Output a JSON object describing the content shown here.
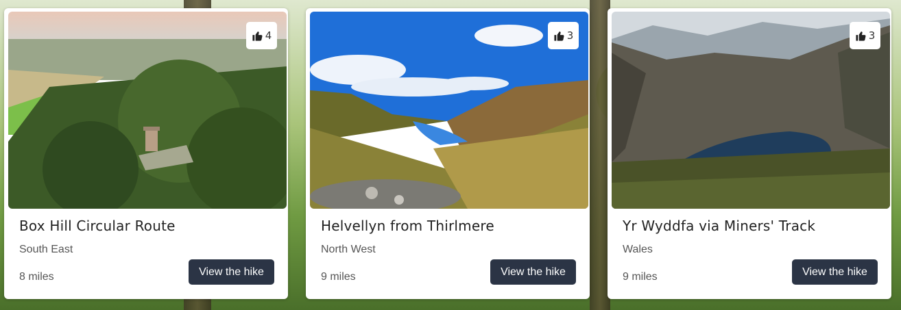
{
  "hikes": [
    {
      "title": "Box Hill Circular Route",
      "region": "South East",
      "distance": "8 miles",
      "likes": "4",
      "button_label": "View the hike",
      "photo_subject": "aerial-forest-tower"
    },
    {
      "title": "Helvellyn from Thirlmere",
      "region": "North West",
      "distance": "9 miles",
      "likes": "3",
      "button_label": "View the hike",
      "photo_subject": "valley-lake-blue-sky"
    },
    {
      "title": "Yr Wyddfa via Miners' Track",
      "region": "Wales",
      "distance": "9 miles",
      "likes": "3",
      "button_label": "View the hike",
      "photo_subject": "mountain-lake"
    }
  ],
  "icons": {
    "like": "thumbs-up-icon"
  },
  "colors": {
    "button_bg": "#2b3445",
    "card_bg": "#ffffff"
  }
}
